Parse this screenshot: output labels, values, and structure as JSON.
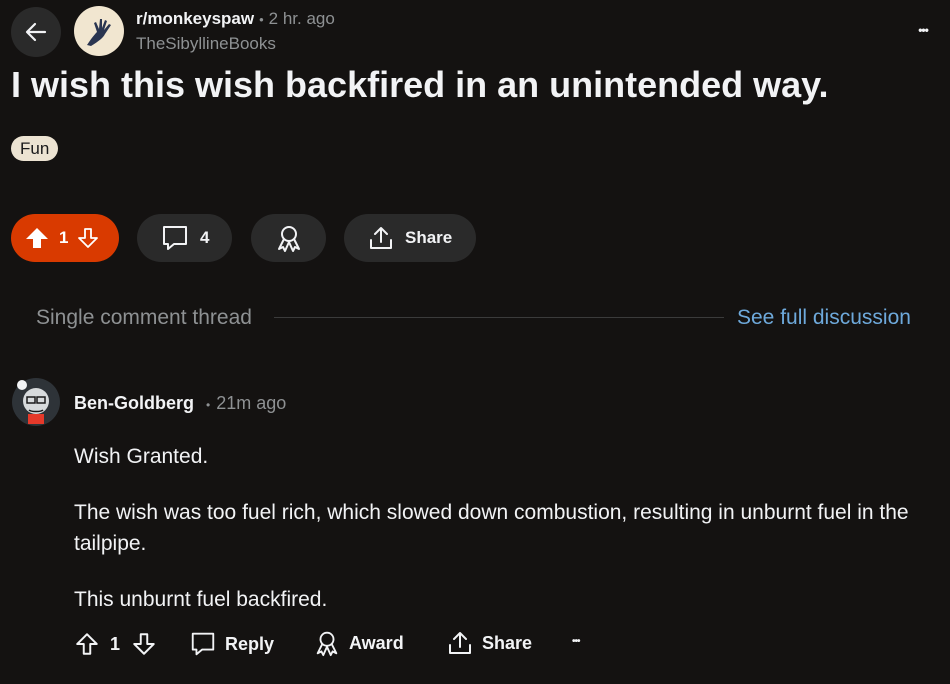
{
  "post": {
    "subreddit": "r/monkeyspaw",
    "separator": "•",
    "time": "2 hr. ago",
    "author": "TheSibyllineBooks",
    "title": "I wish this wish backfired in an unintended way.",
    "flair": "Fun",
    "upvotes": "1",
    "comments": "4",
    "share_label": "Share",
    "accent_color": "#d93a00"
  },
  "thread": {
    "label": "Single comment thread",
    "see_full": "See full discussion"
  },
  "comment": {
    "author": "Ben-Goldberg",
    "separator": "•",
    "time": "21m ago",
    "paragraphs": [
      "Wish Granted.",
      "The wish was too fuel rich, which slowed down combustion, resulting in unburnt fuel in the tailpipe.",
      "This unburnt fuel backfired."
    ],
    "votes": "1",
    "reply_label": "Reply",
    "award_label": "Award",
    "share_label": "Share",
    "more_label": "•••"
  },
  "header": {
    "more_label": "•••"
  }
}
